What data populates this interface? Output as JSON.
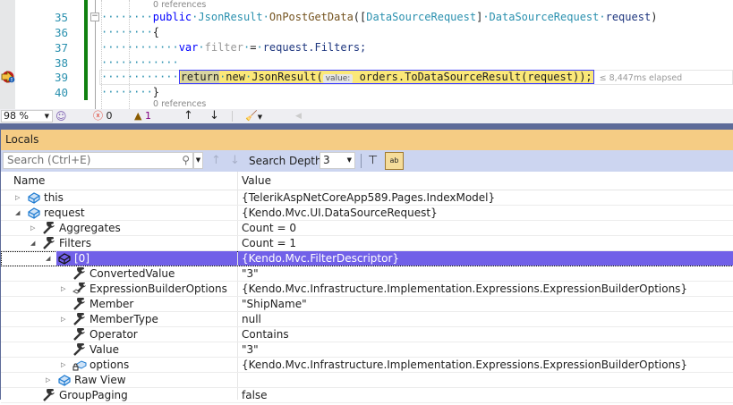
{
  "editor": {
    "references_top": "0 references",
    "references_bottom": "0 references",
    "line_numbers": [
      "35",
      "36",
      "37",
      "38",
      "39",
      "40"
    ],
    "lines": {
      "l35": {
        "kw": "public",
        "t1": "JsonResult",
        "fn": "OnPostGetData",
        "p1": "([",
        "attr": "DataSourceRequest",
        "p2": "]",
        "t2": "DataSourceRequest",
        "param": "request",
        "p3": ")"
      },
      "l36": "{",
      "l37": {
        "kw": "var",
        "var": "filter",
        "eq": "=",
        "expr": "request.Filters;"
      },
      "l39": {
        "ret": "return",
        "kw": "new",
        "t": "JsonResult(",
        "hint": "value:",
        "expr": "orders.ToDataSourceResult(request));",
        "elapsed": "≤ 8,447ms elapsed"
      },
      "l40": "}"
    },
    "current_line": "39",
    "highlight_color": "#fbe878"
  },
  "statusbar": {
    "zoom": "98 %",
    "errors": "0",
    "warnings": "1"
  },
  "locals": {
    "title": "Locals",
    "search_placeholder": "Search (Ctrl+E)",
    "search_depth_label": "Search Depth:",
    "search_depth_value": "3",
    "columns": {
      "name": "Name",
      "value": "Value"
    },
    "rows": [
      {
        "name": "this",
        "value": "{TelerikAspNetCoreApp589.Pages.IndexModel}",
        "level": 0,
        "expander": "collapsed",
        "icon": "object-icon"
      },
      {
        "name": "request",
        "value": "{Kendo.Mvc.UI.DataSourceRequest}",
        "level": 0,
        "expander": "expanded",
        "icon": "object-icon"
      },
      {
        "name": "Aggregates",
        "value": "Count = 0",
        "level": 1,
        "expander": "collapsed",
        "icon": "wrench-icon"
      },
      {
        "name": "Filters",
        "value": "Count = 1",
        "level": 1,
        "expander": "expanded",
        "icon": "wrench-icon"
      },
      {
        "name": "[0]",
        "value": "{Kendo.Mvc.FilterDescriptor}",
        "level": 2,
        "expander": "expanded",
        "icon": "object-icon",
        "selected": true
      },
      {
        "name": "ConvertedValue",
        "value": "\"3\"",
        "level": 3,
        "expander": "none",
        "icon": "wrench-icon"
      },
      {
        "name": "ExpressionBuilderOptions",
        "value": "{Kendo.Mvc.Infrastructure.Implementation.Expressions.ExpressionBuilderOptions}",
        "level": 3,
        "expander": "collapsed",
        "icon": "wrench-object-icon"
      },
      {
        "name": "Member",
        "value": "\"ShipName\"",
        "level": 3,
        "expander": "none",
        "icon": "wrench-icon"
      },
      {
        "name": "MemberType",
        "value": "null",
        "level": 3,
        "expander": "collapsed",
        "icon": "wrench-icon"
      },
      {
        "name": "Operator",
        "value": "Contains",
        "level": 3,
        "expander": "none",
        "icon": "wrench-icon"
      },
      {
        "name": "Value",
        "value": "\"3\"",
        "level": 3,
        "expander": "none",
        "icon": "wrench-icon"
      },
      {
        "name": "options",
        "value": "{Kendo.Mvc.Infrastructure.Implementation.Expressions.ExpressionBuilderOptions}",
        "level": 3,
        "expander": "collapsed",
        "icon": "private-field-icon"
      },
      {
        "name": "Raw View",
        "value": "",
        "level": 2,
        "expander": "collapsed",
        "icon": "object-icon"
      },
      {
        "name": "GroupPaging",
        "value": "false",
        "level": 1,
        "expander": "none",
        "icon": "wrench-icon"
      }
    ],
    "selection_color": "#7160e8",
    "header_color": "#f5cc84"
  }
}
